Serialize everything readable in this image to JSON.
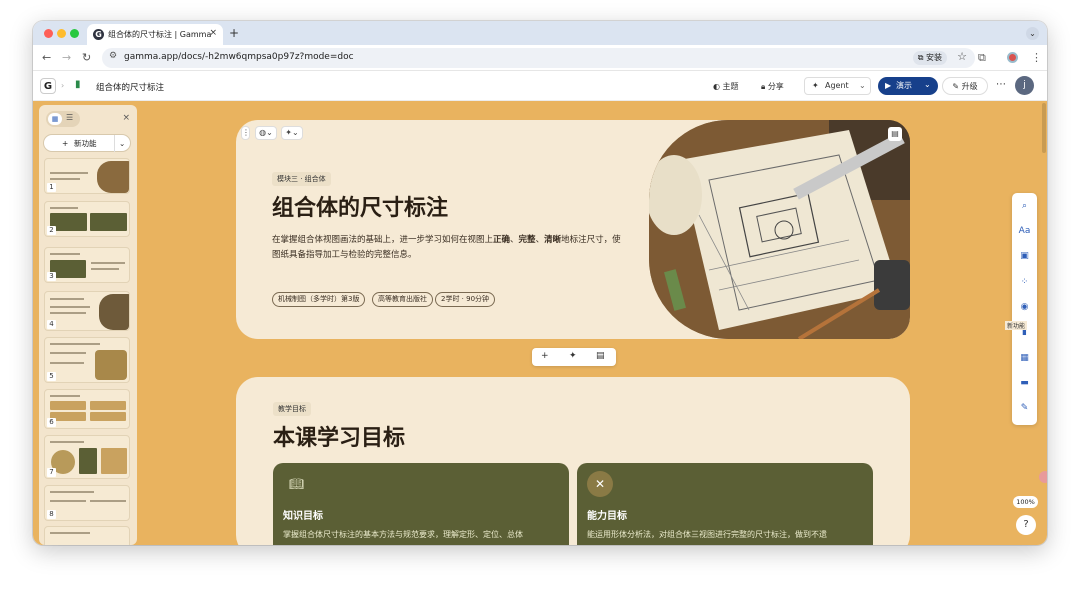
{
  "browser": {
    "tab_title": "组合体的尺寸标注 | Gamma",
    "tab_close": "×",
    "new_tab": "+",
    "url": "gamma.app/docs/-h2mw6qmpsa0p97z?mode=doc",
    "install_label": "安装"
  },
  "toolbar": {
    "doc_title": "组合体的尺寸标注",
    "theme_label": "主题",
    "share_label": "分享",
    "agent_label": "Agent",
    "present_label": "演示",
    "upgrade_label": "升级",
    "avatar_letter": "j"
  },
  "sidebar": {
    "new_feature_label": "新功能",
    "close": "×",
    "slides": [
      {
        "number": "1"
      },
      {
        "number": "2"
      },
      {
        "number": "3"
      },
      {
        "number": "4"
      },
      {
        "number": "5"
      },
      {
        "number": "6"
      },
      {
        "number": "7"
      },
      {
        "number": "8"
      }
    ]
  },
  "hero": {
    "tag": "模块三 · 组合体",
    "title": "组合体的尺寸标注",
    "desc_before": "在掌握组合体视图画法的基础上，进一步学习如何在视图上",
    "desc_bold1": "正确",
    "desc_sep1": "、",
    "desc_bold2": "完整",
    "desc_sep2": "、",
    "desc_bold3": "清晰",
    "desc_after": "地标注尺寸，使图纸具备指导加工与检验的完整信息。",
    "pills": [
      "机械制图（多学时）第3版",
      "高等教育出版社",
      "2学时 · 90分钟"
    ]
  },
  "objectives": {
    "tag": "教学目标",
    "title": "本课学习目标",
    "cards": [
      {
        "title": "知识目标",
        "desc": "掌握组合体尺寸标注的基本方法与规范要求，理解定形、定位、总体"
      },
      {
        "title": "能力目标",
        "desc": "能运用形体分析法，对组合体三视图进行完整的尺寸标注，做到不遗"
      }
    ]
  },
  "rail": {
    "new_badge": "新功能",
    "zoom": "100%",
    "help": "?"
  },
  "colors": {
    "canvas": "#e9b35f",
    "card": "#f6ead5",
    "olive": "#5b5f35",
    "present": "#17408b"
  }
}
